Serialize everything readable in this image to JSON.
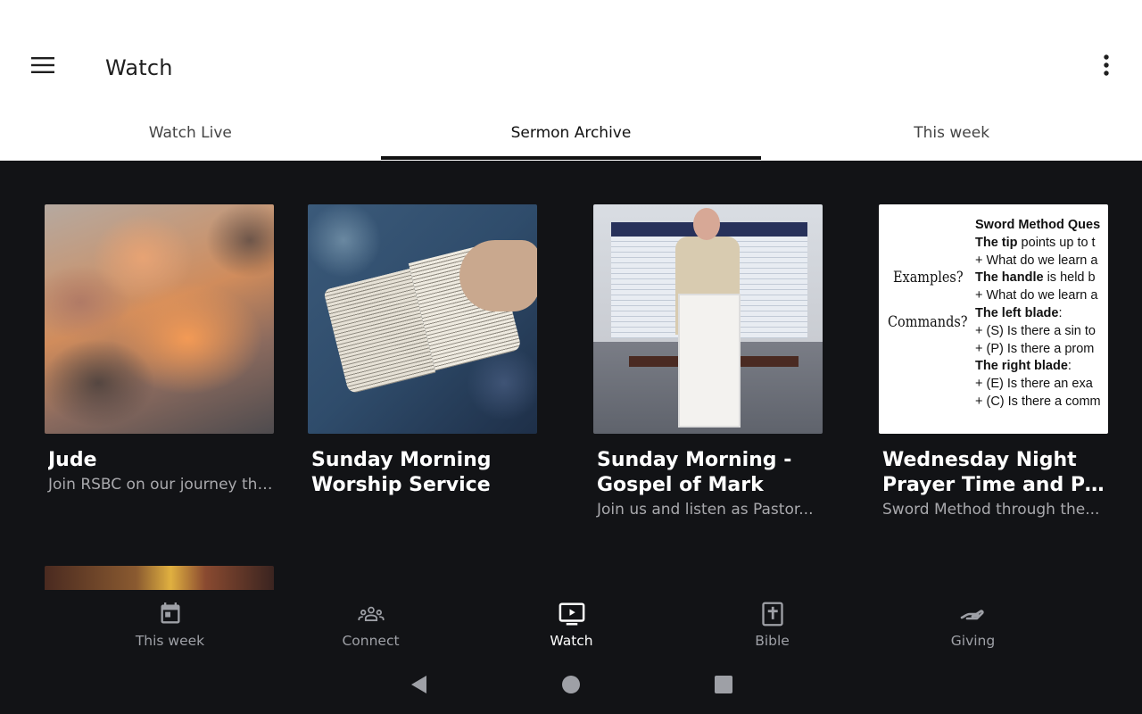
{
  "app_bar": {
    "title": "Watch",
    "menu_icon": "hamburger-menu-icon",
    "more_icon": "more-vert-icon"
  },
  "tabs": [
    {
      "label": "Watch Live",
      "active": false
    },
    {
      "label": "Sermon Archive",
      "active": true
    },
    {
      "label": "This week",
      "active": false
    }
  ],
  "cards": [
    {
      "title_line1": "Jude",
      "title_line2": "",
      "subtitle": "Join RSBC on our journey thr..."
    },
    {
      "title_line1": "Sunday Morning",
      "title_line2": "Worship Service",
      "subtitle": ""
    },
    {
      "title_line1": "Sunday Morning -",
      "title_line2": "Gospel of Mark",
      "subtitle": "Join us and listen as Pastor..."
    },
    {
      "title_line1": "Wednesday Night",
      "title_line2": "Prayer Time and Psal...",
      "subtitle": "Sword Method through the..."
    }
  ],
  "sword_thumb": {
    "heading": "Sword Method Ques",
    "lines": [
      {
        "bold": "The tip",
        "rest": " points up to t"
      },
      {
        "bold": "",
        "rest": "+ What do we learn a"
      },
      {
        "bold": "The handle",
        "rest": " is held b"
      },
      {
        "bold": "",
        "rest": "+ What do we learn a"
      },
      {
        "bold": "The left blade",
        "rest": ":"
      },
      {
        "bold": "",
        "rest": "+ (S) Is there a sin to"
      },
      {
        "bold": "",
        "rest": "+ (P) Is there a prom"
      },
      {
        "bold": "The right blade",
        "rest": ":"
      },
      {
        "bold": "",
        "rest": "+ (E) Is there an exa"
      },
      {
        "bold": "",
        "rest": "+ (C) Is there a comm"
      }
    ],
    "hand_labels": [
      "Examples?",
      "Commands?"
    ]
  },
  "bottom_nav": [
    {
      "label": "This week",
      "icon": "calendar-icon",
      "active": false
    },
    {
      "label": "Connect",
      "icon": "groups-icon",
      "active": false
    },
    {
      "label": "Watch",
      "icon": "video-play-icon",
      "active": true
    },
    {
      "label": "Bible",
      "icon": "bible-icon",
      "active": false
    },
    {
      "label": "Giving",
      "icon": "giving-hand-icon",
      "active": false
    }
  ],
  "system_nav": {
    "back_icon": "back-triangle-icon",
    "home_icon": "home-circle-icon",
    "recents_icon": "recents-square-icon"
  },
  "colors": {
    "background": "#121316",
    "app_bar": "#ffffff",
    "active_text": "#ffffff",
    "inactive_text": "#9ea0a6",
    "subtitle": "#a9a9ad"
  }
}
